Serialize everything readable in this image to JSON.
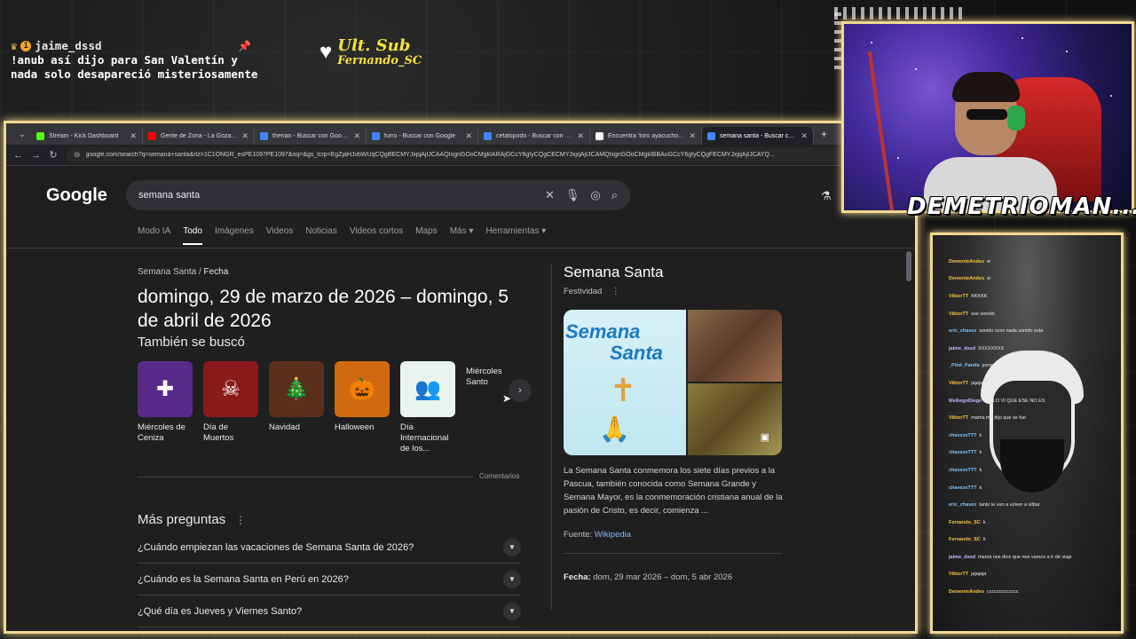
{
  "alert": {
    "username": "jaime_dssd",
    "badge": "1",
    "message_line1": "!anub así dijo para San Valentín y",
    "message_line2": "nada solo desapareció misteriosamente"
  },
  "ult_sub": {
    "label": "Ult. Sub",
    "name": "Fernando_SC"
  },
  "browser": {
    "tabs": [
      {
        "title": "Stream - Kick Dashboard",
        "color": "#53fc18",
        "active": false
      },
      {
        "title": "Gente de Zona - La Gozadera (",
        "color": "#ff0000",
        "active": false
      },
      {
        "title": "therian - Buscar con Google",
        "color": "#4285f4",
        "active": false
      },
      {
        "title": "furro - Buscar con Google",
        "color": "#4285f4",
        "active": false
      },
      {
        "title": "cefalopodo - Buscar con Goog",
        "color": "#4285f4",
        "active": false
      },
      {
        "title": "Encuentra 'toro ayacucho' en T",
        "color": "#ffffff",
        "active": false
      },
      {
        "title": "semana santa - Buscar con Go",
        "color": "#4285f4",
        "active": true
      }
    ],
    "url": "google.com/search?q=semana+santa&rlz=1C1ONGR_esPE1097PE1097&oq=&gs_lcrp=EgZjaHJvbWUqCQgBECMYJxjqAjIJCAAQIxgnGOoCMgkIARAjGCcY6gIyCQgCECMYJxjqAjIJCAMQIxgnGOoCMgkIBBAuGCcY6gIyCQgFECMYJxjqAjIJCAYQ..."
  },
  "google": {
    "logo": "Google",
    "query": "semana santa",
    "nav_tabs": [
      "Modo IA",
      "Todo",
      "Imágenes",
      "Videos",
      "Noticias",
      "Videos cortos",
      "Maps",
      "Más ▾",
      "Herramientas ▾"
    ],
    "active_tab": "Todo",
    "breadcrumb_a": "Semana Santa",
    "breadcrumb_sep": " / ",
    "breadcrumb_b": "Fecha",
    "answer": "domingo, 29 de marzo de 2026 – domingo, 5 de abril de 2026",
    "also_searched_title": "También se buscó",
    "also_searched": [
      {
        "label": "Miércoles de Ceniza",
        "bg": "#5a2a8a",
        "glyph": "✚"
      },
      {
        "label": "Día de Muertos",
        "bg": "#8a1a1a",
        "glyph": "☠"
      },
      {
        "label": "Navidad",
        "bg": "#5a2f1c",
        "glyph": "🎄"
      },
      {
        "label": "Halloween",
        "bg": "#d06a10",
        "glyph": "🎃"
      },
      {
        "label": "Día Internacional de los...",
        "bg": "#e9f4ee",
        "glyph": "👥"
      },
      {
        "label": "Miércoles Santo",
        "bg": "#1f1f1f",
        "glyph": ""
      }
    ],
    "feedback": "Comentarios",
    "paa_title": "Más preguntas",
    "paa": [
      "¿Cuándo empiezan las vacaciones de Semana Santa de 2026?",
      "¿Cuándo es la Semana Santa en Perú en 2026?",
      "¿Qué día es Jueves y Viernes Santo?"
    ],
    "kp": {
      "title": "Semana Santa",
      "subtitle": "Festividad",
      "image_word1": "Semana",
      "image_word2": "Santa",
      "description": "La Semana Santa conmemora los siete días previos a la Pascua, también conocida como Semana Grande y Semana Mayor,  es la conmemoración cristiana anual de la pasión de Cristo, es decir, comienza ...",
      "source_label": "Fuente: ",
      "source_link": "Wikipedia",
      "date_label": "Fecha:",
      "date_value": " dom, 29 mar 2026 – dom, 5 abr 2026"
    }
  },
  "streamer": {
    "name": "DEMETRIOMAN..."
  },
  "chat": [
    {
      "name": "DementeAndes",
      "color": "#f5c542",
      "msg": "w"
    },
    {
      "name": "DementeAndes",
      "color": "#f5c542",
      "msg": "w"
    },
    {
      "name": "ViktorTT",
      "color": "#f5c542",
      "msg": "KKKKK"
    },
    {
      "name": "ViktorTT",
      "color": "#f5c542",
      "msg": "ese sonido"
    },
    {
      "name": "eric_chavez",
      "color": "#7cc4ff",
      "msg": "sonido xxxx nada sonido esta"
    },
    {
      "name": "jaime_dssd",
      "color": "#c8b6ff",
      "msg": "XXXXXXXX"
    },
    {
      "name": "_Pilot_Panda",
      "color": "#7cc4ff",
      "msg": "porque era es la noche la que nos estaba"
    },
    {
      "name": "ViktorTT",
      "color": "#f5c542",
      "msg": "jajajaja"
    },
    {
      "name": "MelkegoDiego",
      "color": "#c8b6ff",
      "msg": "YO LO VI QUE ESE NO ES"
    },
    {
      "name": "ViktorTT",
      "color": "#f5c542",
      "msg": "mama me dijo que se fue"
    },
    {
      "name": "chavezeTTT",
      "color": "#7cc4ff",
      "msg": "k"
    },
    {
      "name": "chavezeTTT",
      "color": "#7cc4ff",
      "msg": "k"
    },
    {
      "name": "chavezeTTT",
      "color": "#7cc4ff",
      "msg": "k"
    },
    {
      "name": "chavezeTTT",
      "color": "#7cc4ff",
      "msg": "k"
    },
    {
      "name": "eric_chavez",
      "color": "#7cc4ff",
      "msg": "tanto le van a volver a silbar"
    },
    {
      "name": "Fernando_SC",
      "color": "#f5c542",
      "msg": "k"
    },
    {
      "name": "Fernando_SC",
      "color": "#f5c542",
      "msg": "k"
    },
    {
      "name": "jaime_dssd",
      "color": "#c8b6ff",
      "msg": "mamá nos dice que nos vamos a ir de viaje"
    },
    {
      "name": "ViktorTT",
      "color": "#f5c542",
      "msg": "jajajaja"
    },
    {
      "name": "DementeAndes",
      "color": "#f5c542",
      "msg": "ccccccccccccc"
    }
  ]
}
